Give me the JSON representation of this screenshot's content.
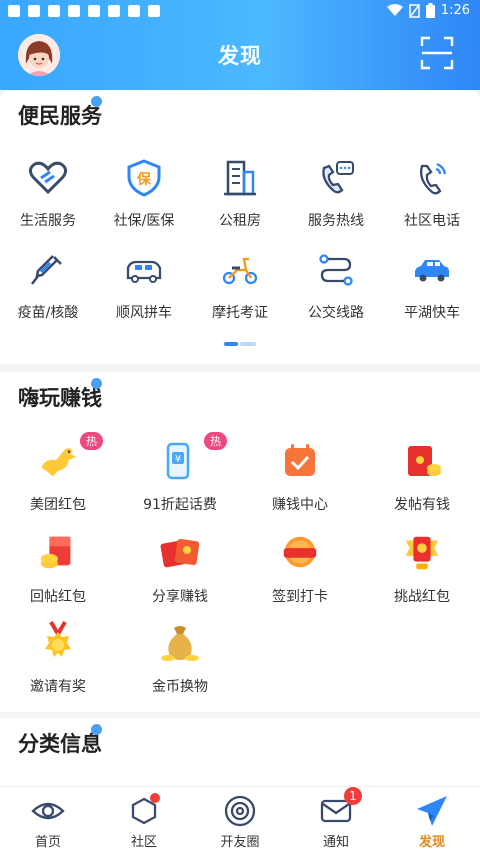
{
  "status_bar": {
    "time": "1:26"
  },
  "header": {
    "title": "发现"
  },
  "sections": {
    "convenience": {
      "title": "便民服务",
      "items": [
        {
          "label": "生活服务",
          "icon": "heart-handshake-icon"
        },
        {
          "label": "社保/医保",
          "icon": "shield-bao-icon"
        },
        {
          "label": "公租房",
          "icon": "building-icon"
        },
        {
          "label": "服务热线",
          "icon": "phone-chat-icon"
        },
        {
          "label": "社区电话",
          "icon": "phone-call-icon"
        },
        {
          "label": "疫苗/核酸",
          "icon": "syringe-icon"
        },
        {
          "label": "顺风拼车",
          "icon": "van-icon"
        },
        {
          "label": "摩托考证",
          "icon": "scooter-icon"
        },
        {
          "label": "公交线路",
          "icon": "route-icon"
        },
        {
          "label": "平湖快车",
          "icon": "car-icon"
        }
      ]
    },
    "earn": {
      "title": "嗨玩赚钱",
      "hot_label": "热",
      "items": [
        {
          "label": "美团红包",
          "icon": "kangaroo-icon"
        },
        {
          "label": "91折起话费",
          "icon": "phone-yuan-icon"
        },
        {
          "label": "赚钱中心",
          "icon": "calendar-check-icon"
        },
        {
          "label": "发帖有钱",
          "icon": "red-envelope-coins-icon"
        },
        {
          "label": "回帖红包",
          "icon": "red-packet-coins-icon"
        },
        {
          "label": "分享赚钱",
          "icon": "red-envelopes-icon"
        },
        {
          "label": "签到打卡",
          "icon": "sign-in-badge-icon"
        },
        {
          "label": "挑战红包",
          "icon": "trophy-envelope-icon"
        },
        {
          "label": "邀请有奖",
          "icon": "medal-icon"
        },
        {
          "label": "金币换物",
          "icon": "money-bag-icon"
        }
      ]
    },
    "classified": {
      "title": "分类信息"
    }
  },
  "tabs": [
    {
      "label": "首页",
      "icon": "eye-icon"
    },
    {
      "label": "社区",
      "icon": "hexagon-icon"
    },
    {
      "label": "开友圈",
      "icon": "spiral-icon"
    },
    {
      "label": "通知",
      "icon": "envelope-icon",
      "badge": "1"
    },
    {
      "label": "发现",
      "icon": "paper-plane-icon",
      "active": true
    }
  ],
  "colors": {
    "accent": "#2f86f6",
    "active_tab": "#e38a1c",
    "hot_badge": "#f0477f"
  }
}
